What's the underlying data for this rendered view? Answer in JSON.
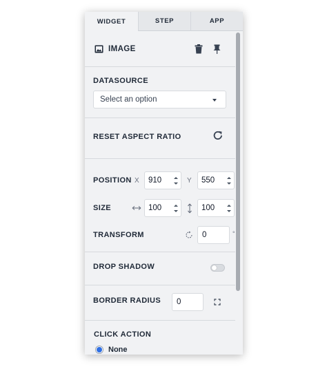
{
  "tabs": [
    {
      "label": "WIDGET",
      "active": true
    },
    {
      "label": "STEP",
      "active": false
    },
    {
      "label": "APP",
      "active": false
    }
  ],
  "widget": {
    "title": "IMAGE",
    "icon": "image-icon"
  },
  "header_actions": [
    "delete-icon",
    "pin-icon"
  ],
  "datasource": {
    "label": "DATASOURCE",
    "placeholder": "Select an option"
  },
  "reset_aspect": {
    "label": "RESET ASPECT RATIO",
    "icon": "refresh-icon"
  },
  "position": {
    "label": "POSITION",
    "x_label": "X",
    "x_value": "910",
    "y_label": "Y",
    "y_value": "550"
  },
  "size": {
    "label": "SIZE",
    "width_icon": "horizontal-resize-icon",
    "width_value": "100",
    "height_icon": "vertical-resize-icon",
    "height_value": "100"
  },
  "transform": {
    "label": "TRANSFORM",
    "icon": "rotate-icon",
    "value": "0",
    "unit": "°"
  },
  "drop_shadow": {
    "label": "DROP SHADOW",
    "enabled": false
  },
  "border_radius": {
    "label": "BORDER RADIUS",
    "value": "0",
    "icon": "corners-icon"
  },
  "click_action": {
    "label": "CLICK ACTION",
    "selected_option": "None"
  },
  "colors": {
    "panel_bg": "#f1f2f4",
    "radio_selected": "#2f6fe4",
    "text": "#1f2937"
  }
}
